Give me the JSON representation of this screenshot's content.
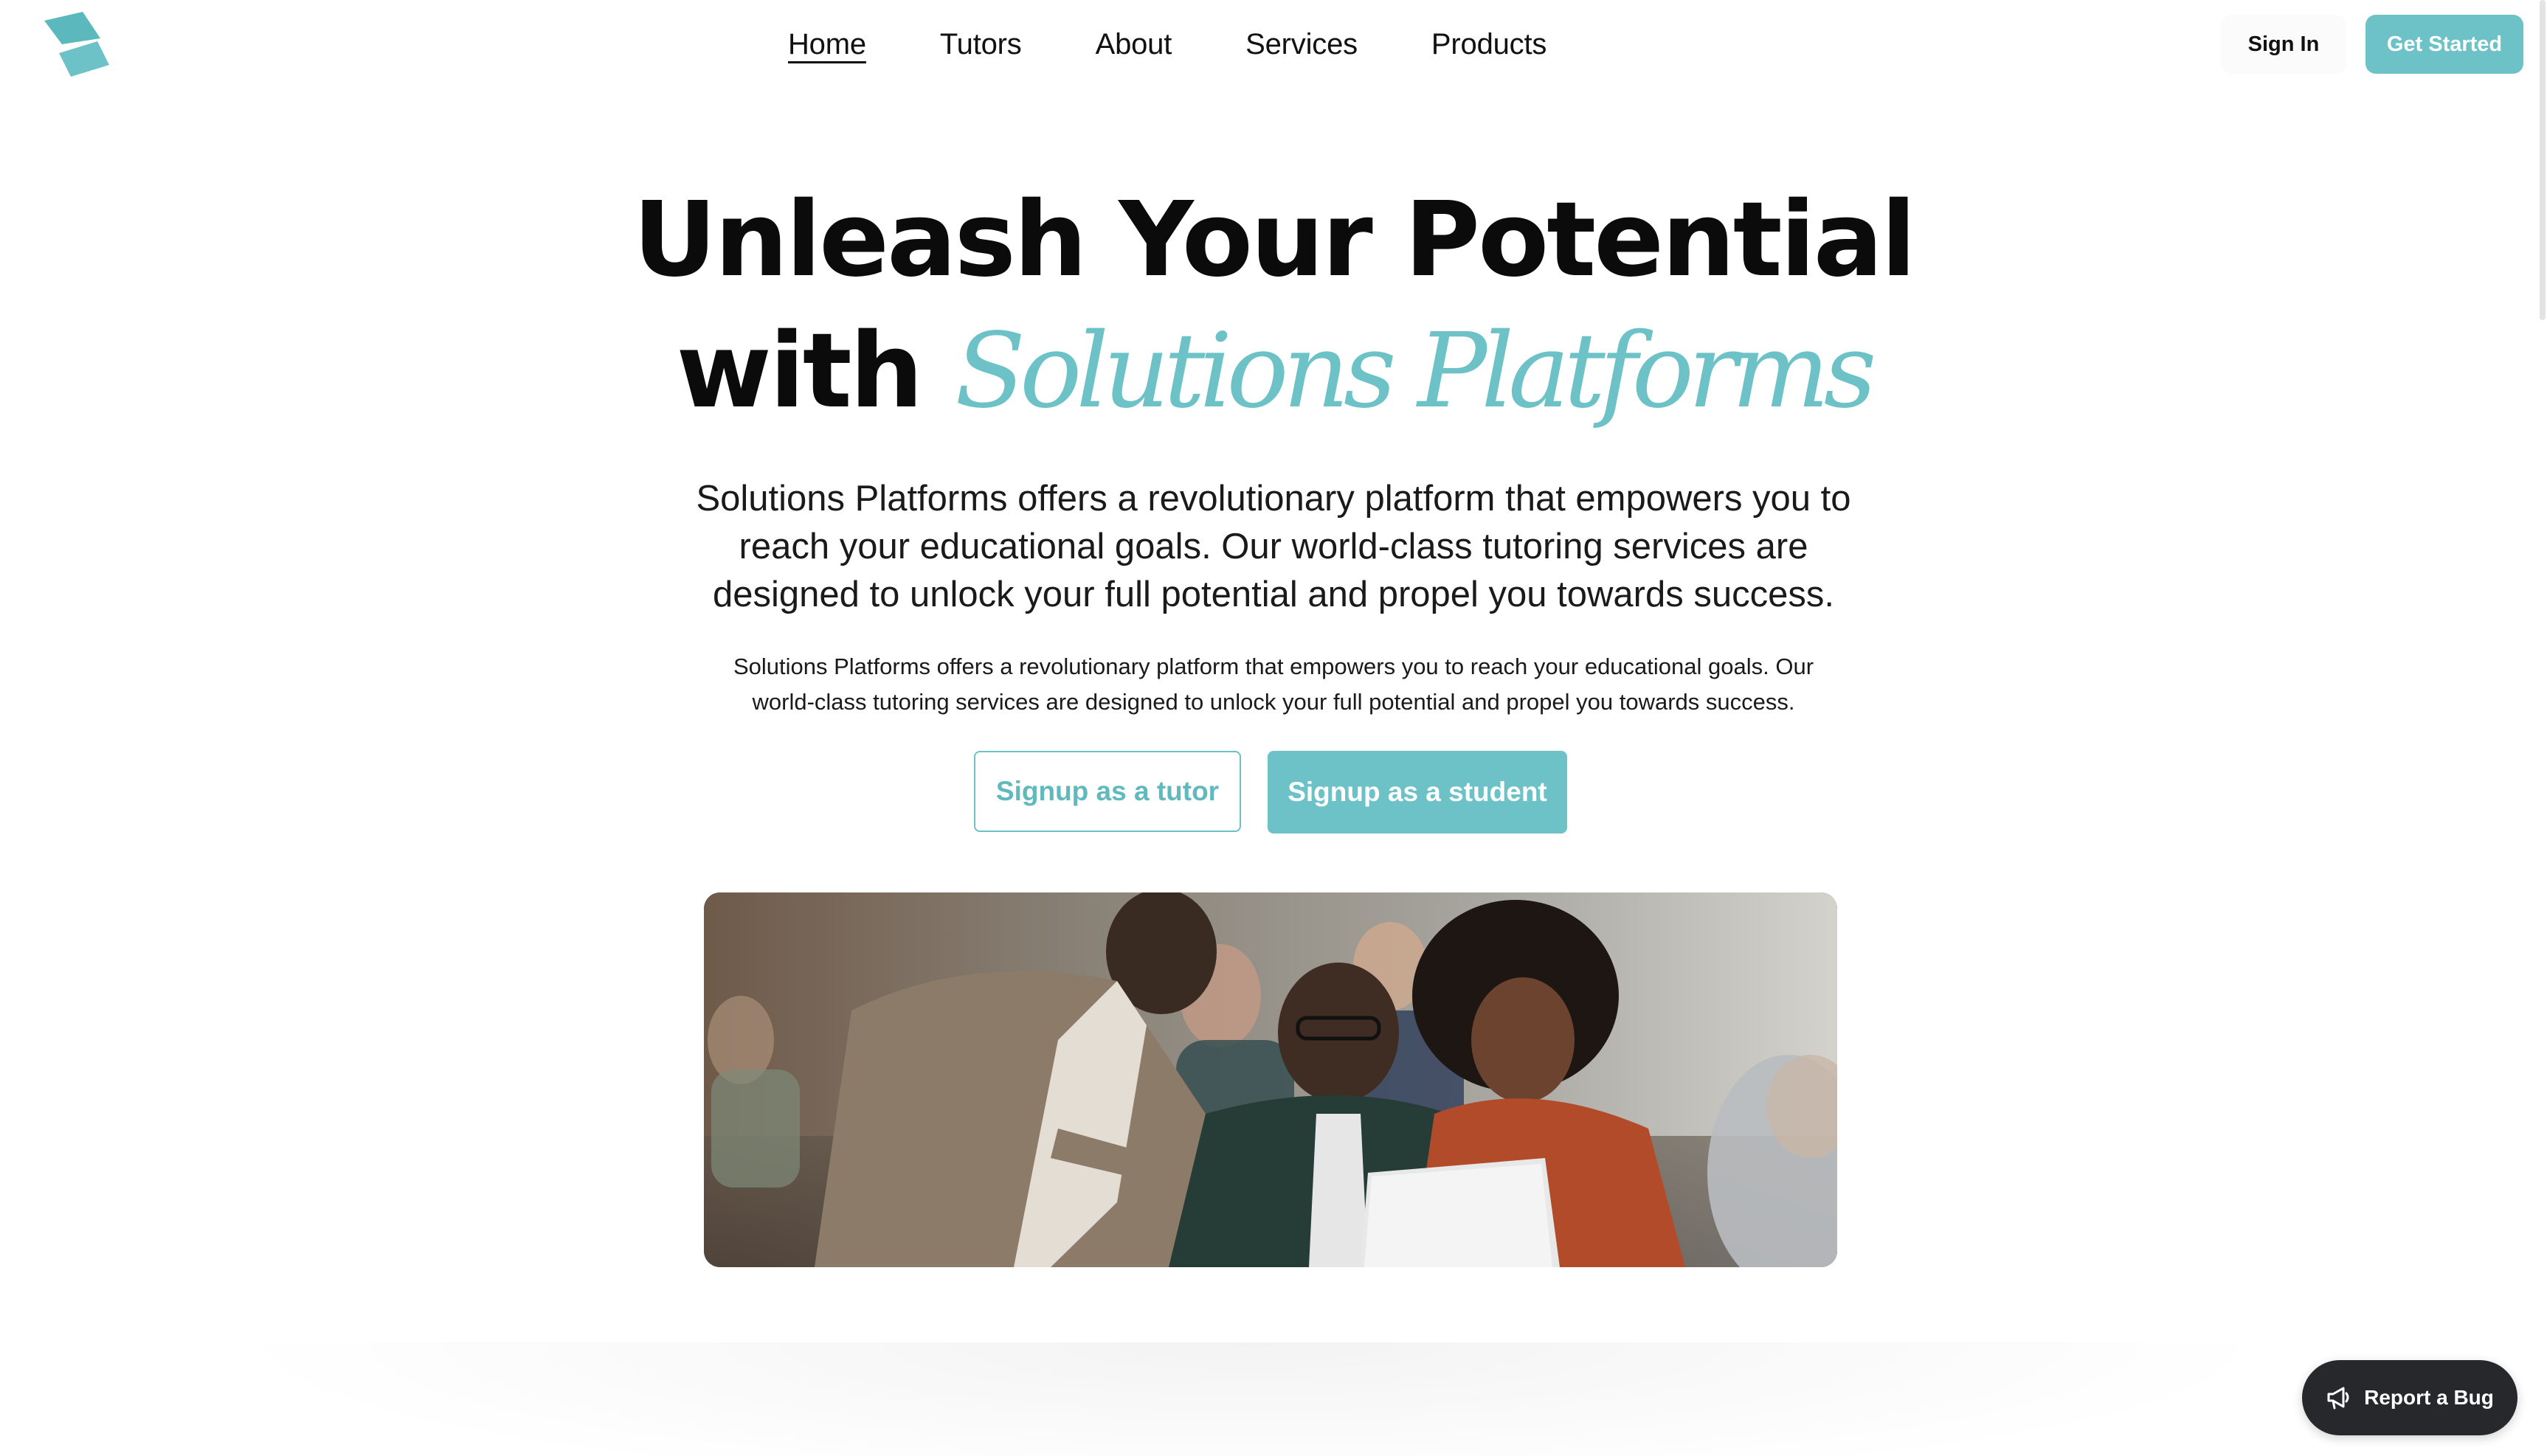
{
  "header": {
    "logo_name": "solutions-platforms-logo",
    "nav": [
      {
        "label": "Home",
        "active": true
      },
      {
        "label": "Tutors",
        "active": false
      },
      {
        "label": "About",
        "active": false
      },
      {
        "label": "Services",
        "active": false
      },
      {
        "label": "Products",
        "active": false
      }
    ],
    "sign_in_label": "Sign In",
    "get_started_label": "Get Started"
  },
  "hero": {
    "headline_line1": "Unleash Your Potential",
    "headline_line2_prefix": "with",
    "headline_line2_accent": "Solutions Platforms",
    "subtitle_large": "Solutions Platforms offers a revolutionary platform that empowers you to reach your educational goals. Our world-class tutoring services are designed to unlock your full potential and propel you towards success.",
    "subtitle_small": "Solutions Platforms offers a revolutionary platform that empowers you to reach your educational goals. Our world-class tutoring services are designed to unlock your full potential and propel you towards success.",
    "tutor_button_label": "Signup as a tutor",
    "student_button_label": "Signup as a student",
    "image_name": "students-studying-photo"
  },
  "report_bug": {
    "label": "Report a Bug",
    "icon": "megaphone-icon"
  },
  "colors": {
    "accent": "#6cc2c6",
    "text": "#111111",
    "bug_button_bg": "#26282b"
  }
}
